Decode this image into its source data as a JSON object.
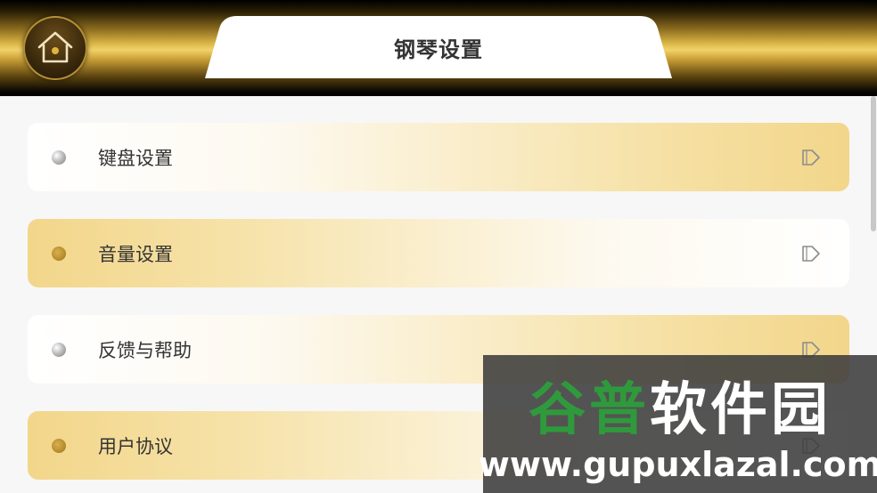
{
  "header": {
    "title": "钢琴设置",
    "home_icon": "home-icon"
  },
  "list": {
    "items": [
      {
        "label": "键盘设置",
        "dot_style": "silver",
        "row_style": "light",
        "arrow_icon": "arrow-right-icon"
      },
      {
        "label": "音量设置",
        "dot_style": "gold",
        "row_style": "gold",
        "arrow_icon": "arrow-right-icon"
      },
      {
        "label": "反馈与帮助",
        "dot_style": "silver",
        "row_style": "light",
        "arrow_icon": "arrow-right-icon"
      },
      {
        "label": "用户协议",
        "dot_style": "gold",
        "row_style": "gold",
        "arrow_icon": "arrow-right-icon"
      }
    ]
  },
  "watermark": {
    "title_part1": "谷普",
    "title_part2": "软件园",
    "url": "www.gupuxlazal.com"
  },
  "colors": {
    "gold_light": "#f2d68a",
    "gold_dark": "#b78d2e",
    "text": "#333333",
    "watermark_green": "#2f9a3c"
  }
}
